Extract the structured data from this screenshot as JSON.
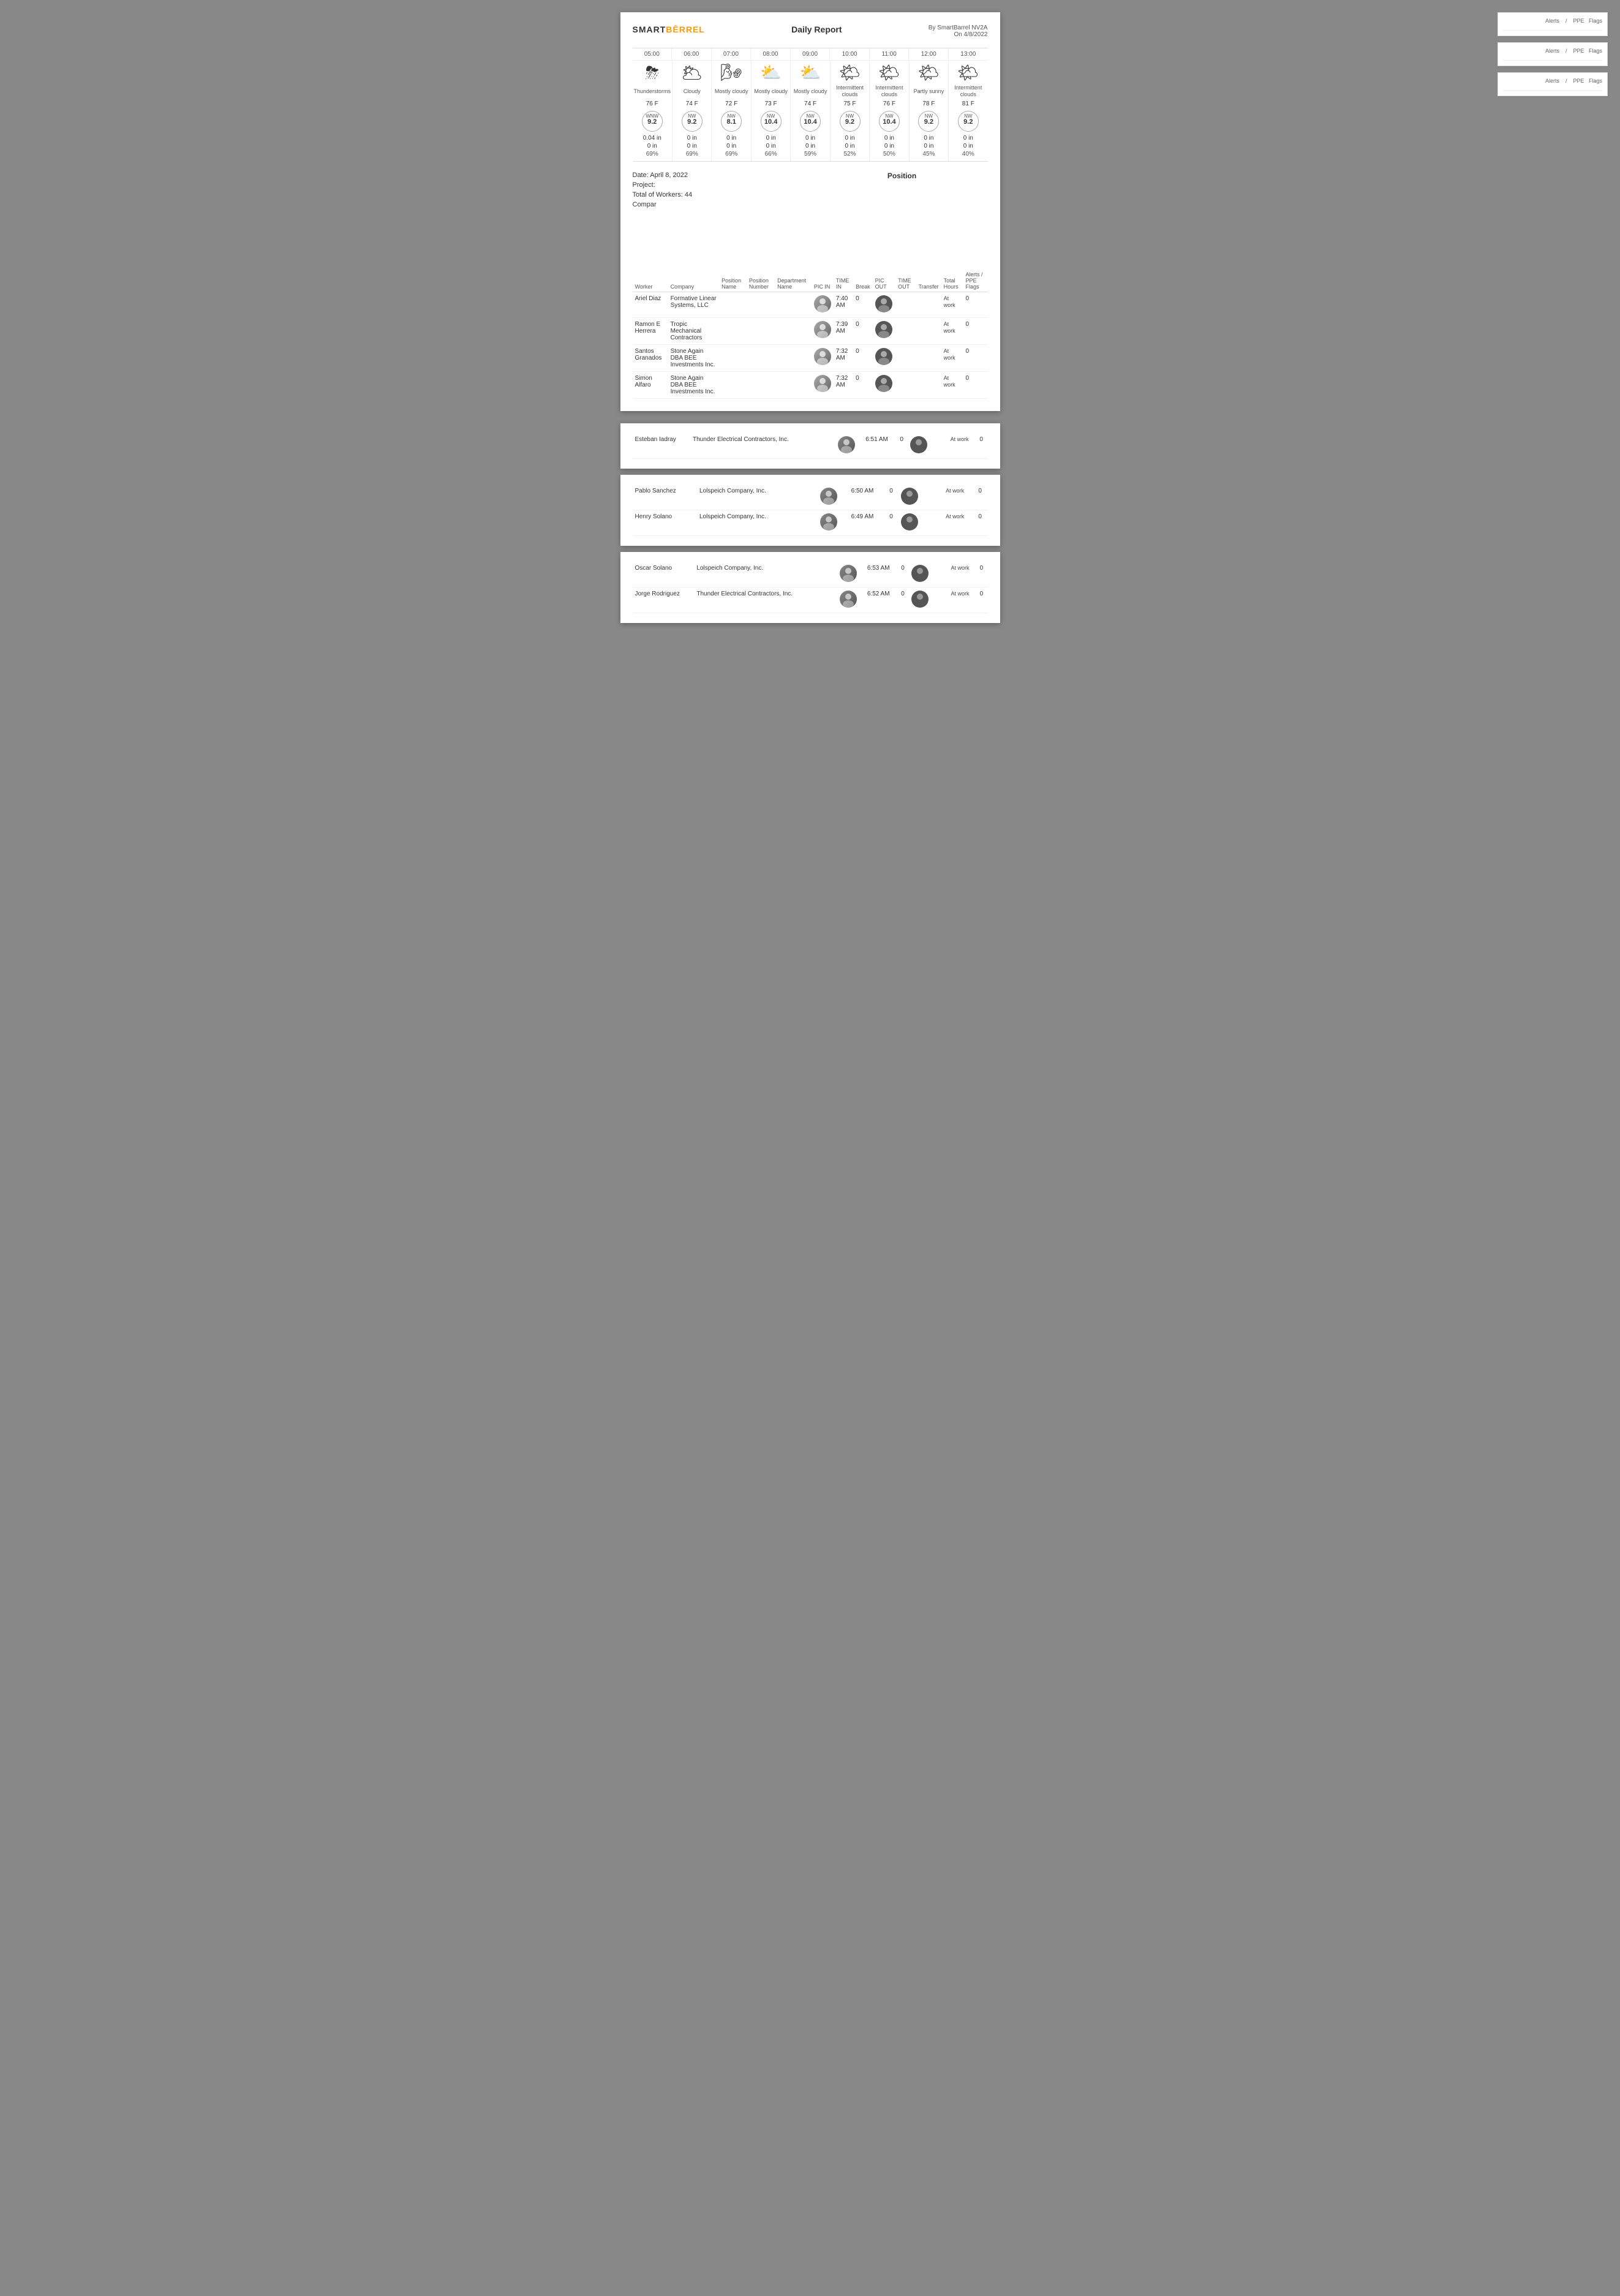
{
  "app": {
    "logo_text": "SMART",
    "logo_accent": "BĒRREL",
    "report_title": "Daily Report",
    "generated_by": "By SmartBarrel NV2A",
    "generated_on": "On 4/8/2022"
  },
  "weather": {
    "times": [
      "05:00",
      "06:00",
      "07:00",
      "08:00",
      "09:00",
      "10:00",
      "11:00",
      "12:00",
      "13:00"
    ],
    "icons": [
      "⛈",
      "🌥",
      "🌬",
      "⛅",
      "⛅",
      "🌤",
      "🌤",
      "🌤",
      "🌤"
    ],
    "descriptions": [
      "Thunderstorms",
      "Cloudy",
      "Mostly cloudy",
      "Mostly cloudy",
      "Mostly cloudy",
      "Intermittent clouds",
      "Intermittent clouds",
      "Partly sunny",
      "Intermittent clouds"
    ],
    "temps": [
      "76 F",
      "74 F",
      "72 F",
      "73 F",
      "74 F",
      "75 F",
      "76 F",
      "78 F",
      "81 F"
    ],
    "wind_dirs": [
      "WNW",
      "NW",
      "NW",
      "NW",
      "NW",
      "NW",
      "NW",
      "NW",
      "NW"
    ],
    "wind_speeds": [
      "9.2",
      "9.2",
      "8.1",
      "10.4",
      "10.4",
      "9.2",
      "10.4",
      "9.2",
      "9.2"
    ],
    "precip_in": [
      "0.04 in",
      "0 in",
      "0 in",
      "0 in",
      "0 in",
      "0 in",
      "0 in",
      "0 in",
      "0 in"
    ],
    "precip2": [
      "0 in",
      "0 in",
      "0 in",
      "0 in",
      "0 in",
      "0 in",
      "0 in",
      "0 in",
      "0 in"
    ],
    "humidity": [
      "69%",
      "69%",
      "69%",
      "66%",
      "59%",
      "52%",
      "50%",
      "45%",
      "40%"
    ]
  },
  "report_info": {
    "date_label": "Date: April 8, 2022",
    "project_label": "Project:",
    "workers_label": "Total of Workers: 44",
    "company_label": "Compar",
    "position_label": "Position"
  },
  "table": {
    "headers": {
      "worker": "Worker",
      "company": "Company",
      "position_name": "Position Name",
      "position_number": "Position Number",
      "department": "Department Name",
      "pic_in": "PIC IN",
      "time_in": "TIME IN",
      "break": "Break",
      "pic_out": "PIC OUT",
      "time_out": "TIME OUT",
      "transfer": "Transfer",
      "total_hours": "Total Hours",
      "alerts": "Alerts / PPE Flags"
    },
    "rows": [
      {
        "worker": "Ariel Diaz",
        "company": "Formative Linear Systems, LLC",
        "position_name": "",
        "position_number": "",
        "department": "",
        "time_in": "7:40 AM",
        "break": "0",
        "time_out": "",
        "transfer": "",
        "status": "At work",
        "total_hours": "0",
        "alerts": ""
      },
      {
        "worker": "Ramon E Herrera",
        "company": "Tropic Mechanical Contractors",
        "position_name": "",
        "position_number": "",
        "department": "",
        "time_in": "7:39 AM",
        "break": "0",
        "time_out": "",
        "transfer": "",
        "status": "At work",
        "total_hours": "0",
        "alerts": ""
      },
      {
        "worker": "Santos Granados",
        "company": "Stone Again DBA BEE Investments Inc.",
        "position_name": "",
        "position_number": "",
        "department": "",
        "time_in": "7:32 AM",
        "break": "0",
        "time_out": "",
        "transfer": "",
        "status": "At work",
        "total_hours": "0",
        "alerts": ""
      },
      {
        "worker": "Simon Alfaro",
        "company": "Stone Again DBA BEE Investments Inc.",
        "position_name": "",
        "position_number": "",
        "department": "",
        "time_in": "7:32 AM",
        "break": "0",
        "time_out": "",
        "transfer": "",
        "status": "At work",
        "total_hours": "0",
        "alerts": ""
      }
    ]
  },
  "continuation_rows": [
    {
      "worker": "Esteban Iadray",
      "company": "Thunder Electrical Contractors, Inc.",
      "time_in": "6:51 AM",
      "break": "0",
      "status": "At work",
      "total_hours": "0"
    },
    {
      "worker": "Pablo Sanchez",
      "company": "Lolspeich Company, Inc.",
      "time_in": "6:50 AM",
      "break": "0",
      "status": "At work",
      "total_hours": "0"
    },
    {
      "worker": "Henry Solano",
      "company": "Lolspeich Company, Inc.",
      "time_in": "6:49 AM",
      "break": "0",
      "status": "At work",
      "total_hours": "0"
    },
    {
      "worker": "Oscar Solano",
      "company": "Lolspeich Company, Inc.",
      "time_in": "6:53 AM",
      "break": "0",
      "status": "At work",
      "total_hours": "0"
    },
    {
      "worker": "Jorge Rodriguez",
      "company": "Thunder Electrical Contractors, Inc.",
      "time_in": "6:52 AM",
      "break": "0",
      "status": "At work",
      "total_hours": "0"
    }
  ],
  "sidebar_panels": [
    {
      "rows": [
        {
          "name": "",
          "alerts_ppe": "Alerts / PPE Flags"
        }
      ]
    },
    {
      "rows": [
        {
          "name": "",
          "alerts_ppe": "Alerts / PPE Flags"
        }
      ]
    },
    {
      "rows": [
        {
          "name": "",
          "alerts_ppe": "Alerts / PPE Flags"
        }
      ]
    }
  ]
}
